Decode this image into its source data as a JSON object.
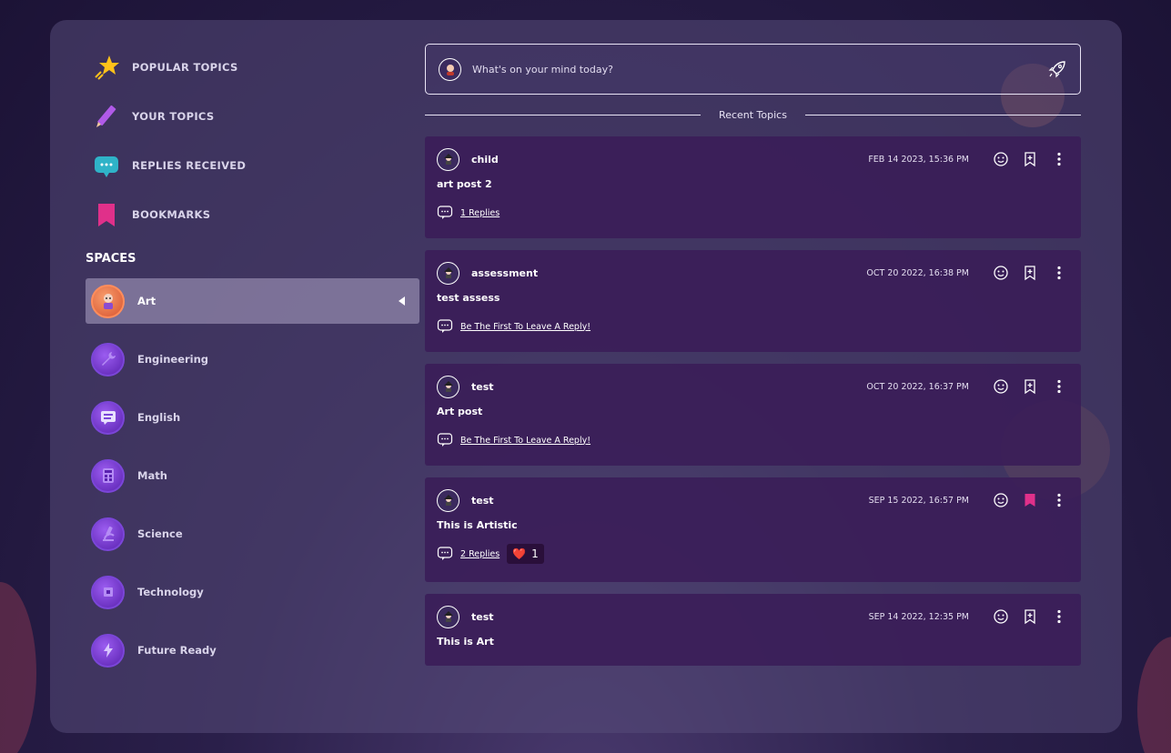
{
  "nav": {
    "items": [
      {
        "label": "POPULAR TOPICS",
        "icon": "star-icon"
      },
      {
        "label": "YOUR TOPICS",
        "icon": "pencil-icon"
      },
      {
        "label": "REPLIES RECEIVED",
        "icon": "chat-bubble-icon"
      },
      {
        "label": "BOOKMARKS",
        "icon": "bookmark-icon"
      }
    ]
  },
  "spaces": {
    "title": "SPACES",
    "items": [
      {
        "label": "Art",
        "active": true
      },
      {
        "label": "Engineering"
      },
      {
        "label": "English"
      },
      {
        "label": "Math"
      },
      {
        "label": "Science"
      },
      {
        "label": "Technology"
      },
      {
        "label": "Future Ready"
      }
    ]
  },
  "composer": {
    "placeholder": "What's on your mind today?"
  },
  "feed": {
    "heading": "Recent Topics",
    "topics": [
      {
        "author": "child",
        "timestamp": "FEB 14 2023, 15:36 PM",
        "title": "art post 2",
        "replies": "1 Replies",
        "bookmarked": false
      },
      {
        "author": "assessment",
        "timestamp": "OCT 20 2022, 16:38 PM",
        "title": "test assess",
        "replies": "Be The First To Leave A Reply!",
        "bookmarked": false
      },
      {
        "author": "test",
        "timestamp": "OCT 20 2022, 16:37 PM",
        "title": "Art post",
        "replies": "Be The First To Leave A Reply!",
        "bookmarked": false
      },
      {
        "author": "test",
        "timestamp": "SEP 15 2022, 16:57 PM",
        "title": "This is Artistic",
        "replies": "2 Replies",
        "bookmarked": true,
        "reaction": {
          "emoji": "❤️",
          "count": "1"
        }
      },
      {
        "author": "test",
        "timestamp": "SEP 14 2022, 12:35 PM",
        "title": "This is Art",
        "bookmarked": false
      }
    ]
  },
  "colors": {
    "panel": "#554a78",
    "card": "#3a1c58",
    "bookmark_active": "#e0308a",
    "star": "#ffc21a"
  }
}
